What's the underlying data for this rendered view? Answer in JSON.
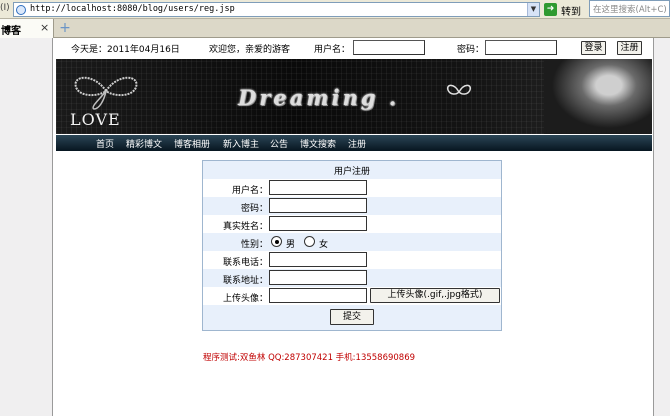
{
  "browser": {
    "address_label": "(I)",
    "url": "http://localhost:8080/blog/users/reg.jsp",
    "go_label": "转到",
    "search_placeholder": "在这里搜索(Alt+C)",
    "tab_label": "博客",
    "tab_close": "×",
    "new_tab": "+"
  },
  "topbar": {
    "date_text": "今天是：2011年04月16日",
    "welcome_text": "欢迎您，亲爱的游客",
    "username_label": "用户名：",
    "password_label": "密码：",
    "login_button": "登录",
    "register_button": "注册"
  },
  "banner": {
    "title": "Dreaming .",
    "love_text": "LOVE"
  },
  "nav": {
    "items": [
      "首页",
      "精彩博文",
      "博客相册",
      "新入博主",
      "公告",
      "博文搜索",
      "注册"
    ]
  },
  "form": {
    "title": "用户注册",
    "username_label": "用户名：",
    "password_label": "密码：",
    "realname_label": "真实姓名：",
    "gender_label": "性别：",
    "gender_options": [
      "男",
      "女"
    ],
    "gender_selected": "男",
    "phone_label": "联系电话：",
    "address_label": "联系地址：",
    "avatar_label": "上传头像：",
    "avatar_button": "上传头像(.gif,.jpg格式)",
    "submit_button": "提交"
  },
  "footer": {
    "credit": "程序测试:双鱼林 QQ:287307421 手机:13558690869"
  }
}
